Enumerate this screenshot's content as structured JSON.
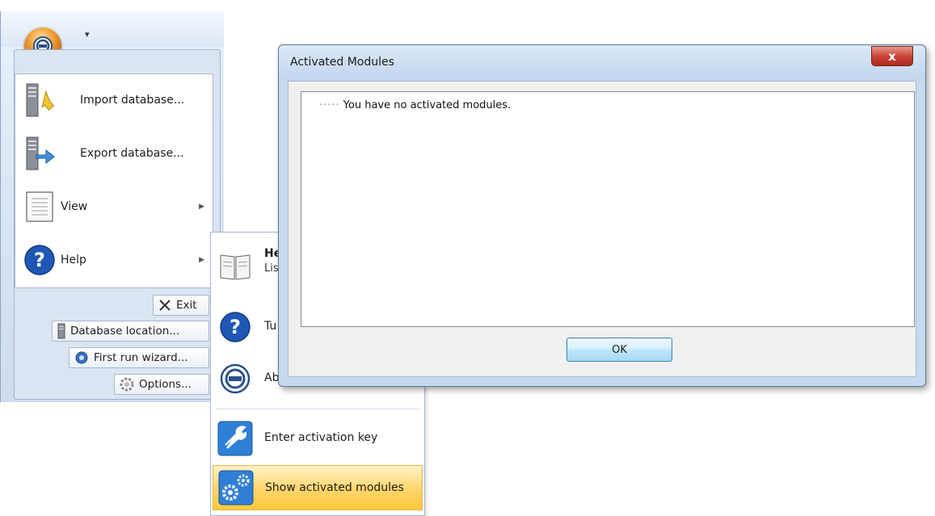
{
  "app": {
    "qat_dropdown": "▾",
    "menu_items": [
      {
        "label": "Import database...",
        "mnemonic": "I",
        "icon": "import-database-icon"
      },
      {
        "label": "Export database...",
        "mnemonic": "E",
        "icon": "export-database-icon"
      },
      {
        "label": "View",
        "icon": "document-view-icon",
        "has_submenu": true
      },
      {
        "label": "Help",
        "icon": "help-icon",
        "has_submenu": true
      }
    ],
    "bottom_buttons": [
      {
        "label": "Exit",
        "mnemonic": "x",
        "icon": "close-x-icon"
      },
      {
        "label": "Database location...",
        "mnemonic": "D",
        "icon": "database-server-icon"
      },
      {
        "label": "First run wizard...",
        "mnemonic": "F",
        "icon": "wizard-gear-icon"
      },
      {
        "label": "Options...",
        "mnemonic": "O",
        "icon": "gear-icon"
      }
    ]
  },
  "submenu": {
    "items": [
      {
        "label": "He",
        "desc": "Lis",
        "icon": "book-icon"
      },
      {
        "label": "Tu",
        "icon": "help-icon"
      },
      {
        "label": "Ab",
        "icon": "app-logo-icon"
      },
      {
        "label": "Enter activation key",
        "icon": "wrench-icon"
      },
      {
        "label": "Show activated modules",
        "icon": "gears-icon",
        "highlighted": true
      }
    ]
  },
  "dialog": {
    "title": "Activated Modules",
    "close_glyph": "x",
    "empty_message": "You have no activated modules.",
    "tree_connector": "·····",
    "ok_label": "OK"
  },
  "colors": {
    "accent_orange": "#f2a33c",
    "highlight_yellow": "#ffd56b",
    "close_red": "#c8443a",
    "ok_blue": "#bee6fd"
  }
}
